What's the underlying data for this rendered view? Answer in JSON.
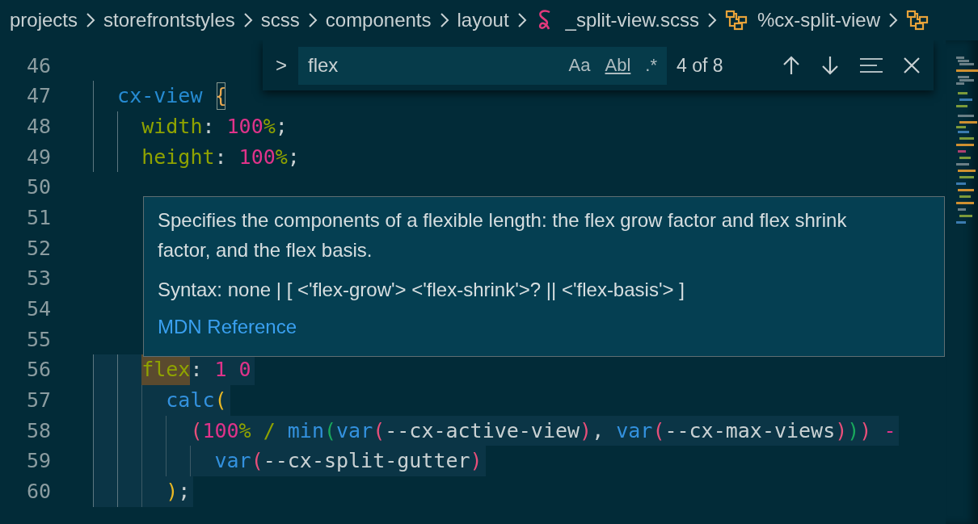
{
  "breadcrumbs": [
    {
      "kind": "folder",
      "label": "projects"
    },
    {
      "kind": "folder",
      "label": "storefrontstyles"
    },
    {
      "kind": "folder",
      "label": "scss"
    },
    {
      "kind": "folder",
      "label": "components"
    },
    {
      "kind": "folder",
      "label": "layout"
    },
    {
      "kind": "file",
      "label": "_split-view.scss"
    },
    {
      "kind": "symbol",
      "label": "%cx-split-view"
    },
    {
      "kind": "symbol"
    }
  ],
  "editor": {
    "lines": [
      {
        "number": "46"
      },
      {
        "number": "47",
        "highlighted": false,
        "code": [
          {
            "kind": "indent-guide"
          },
          {
            "kind": "selector",
            "text": "cx-view "
          },
          {
            "kind": "matched-brace",
            "text": "{"
          }
        ]
      },
      {
        "number": "48",
        "highlighted": false,
        "code": [
          {
            "kind": "indent-guide"
          },
          {
            "kind": "indent-guide"
          },
          {
            "kind": "property",
            "text": "width"
          },
          {
            "kind": "punct",
            "text": ": "
          },
          {
            "kind": "number",
            "text": "100"
          },
          {
            "kind": "unit",
            "text": "%"
          },
          {
            "kind": "punct",
            "text": ";"
          }
        ]
      },
      {
        "number": "49",
        "highlighted": false,
        "code": [
          {
            "kind": "indent-guide"
          },
          {
            "kind": "indent-guide"
          },
          {
            "kind": "property",
            "text": "height"
          },
          {
            "kind": "punct",
            "text": ": "
          },
          {
            "kind": "number",
            "text": "100"
          },
          {
            "kind": "unit",
            "text": "%"
          },
          {
            "kind": "punct",
            "text": ";"
          }
        ]
      },
      {
        "number": "50"
      },
      {
        "number": "51"
      },
      {
        "number": "52"
      },
      {
        "number": "53"
      },
      {
        "number": "54"
      },
      {
        "number": "55"
      },
      {
        "number": "56",
        "highlighted": true,
        "code": [
          {
            "kind": "indent-guide"
          },
          {
            "kind": "indent-guide"
          },
          {
            "kind": "match",
            "text": "flex"
          },
          {
            "kind": "punct",
            "text": ": "
          },
          {
            "kind": "number",
            "text": "1 0"
          }
        ]
      },
      {
        "number": "57",
        "highlighted": true,
        "code": [
          {
            "kind": "indent-guide"
          },
          {
            "kind": "indent-guide"
          },
          {
            "kind": "indent-guide"
          },
          {
            "kind": "function",
            "text": "calc"
          },
          {
            "kind": "bracket1",
            "text": "("
          }
        ]
      },
      {
        "number": "58",
        "highlighted": true,
        "code": [
          {
            "kind": "indent-guide"
          },
          {
            "kind": "indent-guide"
          },
          {
            "kind": "indent-guide"
          },
          {
            "kind": "indent-guide"
          },
          {
            "kind": "bracket2",
            "text": "("
          },
          {
            "kind": "number",
            "text": "100"
          },
          {
            "kind": "unit",
            "text": "%"
          },
          {
            "kind": "unit",
            "text": " / "
          },
          {
            "kind": "function",
            "text": "min"
          },
          {
            "kind": "bracket3",
            "text": "("
          },
          {
            "kind": "function",
            "text": "var"
          },
          {
            "kind": "bracket2",
            "text": "("
          },
          {
            "kind": "plain",
            "text": "--cx-active-view"
          },
          {
            "kind": "bracket2",
            "text": ")"
          },
          {
            "kind": "punct",
            "text": ", "
          },
          {
            "kind": "function",
            "text": "var"
          },
          {
            "kind": "bracket2",
            "text": "("
          },
          {
            "kind": "plain",
            "text": "--cx-max-views"
          },
          {
            "kind": "bracket2",
            "text": ")"
          },
          {
            "kind": "bracket3",
            "text": ")"
          },
          {
            "kind": "bracket2",
            "text": ")"
          },
          {
            "kind": "operator",
            "text": " -"
          }
        ]
      },
      {
        "number": "59",
        "highlighted": true,
        "code": [
          {
            "kind": "indent-guide"
          },
          {
            "kind": "indent-guide"
          },
          {
            "kind": "indent-guide"
          },
          {
            "kind": "indent-guide"
          },
          {
            "kind": "indent-guide"
          },
          {
            "kind": "function",
            "text": "var"
          },
          {
            "kind": "bracket2",
            "text": "("
          },
          {
            "kind": "plain",
            "text": "--cx-split-gutter"
          },
          {
            "kind": "bracket2",
            "text": ")"
          }
        ]
      },
      {
        "number": "60",
        "highlighted": true,
        "code": [
          {
            "kind": "indent-guide"
          },
          {
            "kind": "indent-guide"
          },
          {
            "kind": "indent-guide"
          },
          {
            "kind": "bracket1",
            "text": ")"
          },
          {
            "kind": "punct",
            "text": ";"
          }
        ]
      }
    ]
  },
  "find_widget": {
    "toggle": ">",
    "value": "flex",
    "options": [
      "Aa",
      "Abl",
      ".*"
    ],
    "count": "4 of 8"
  },
  "hover": {
    "description": "Specifies the components of a flexible length: the flex grow factor and flex shrink factor, and the flex basis.",
    "syntax": "Syntax: none | [ <'flex-grow'> <'flex-shrink'>? || <'flex-basis'> ]",
    "link": "MDN Reference"
  }
}
